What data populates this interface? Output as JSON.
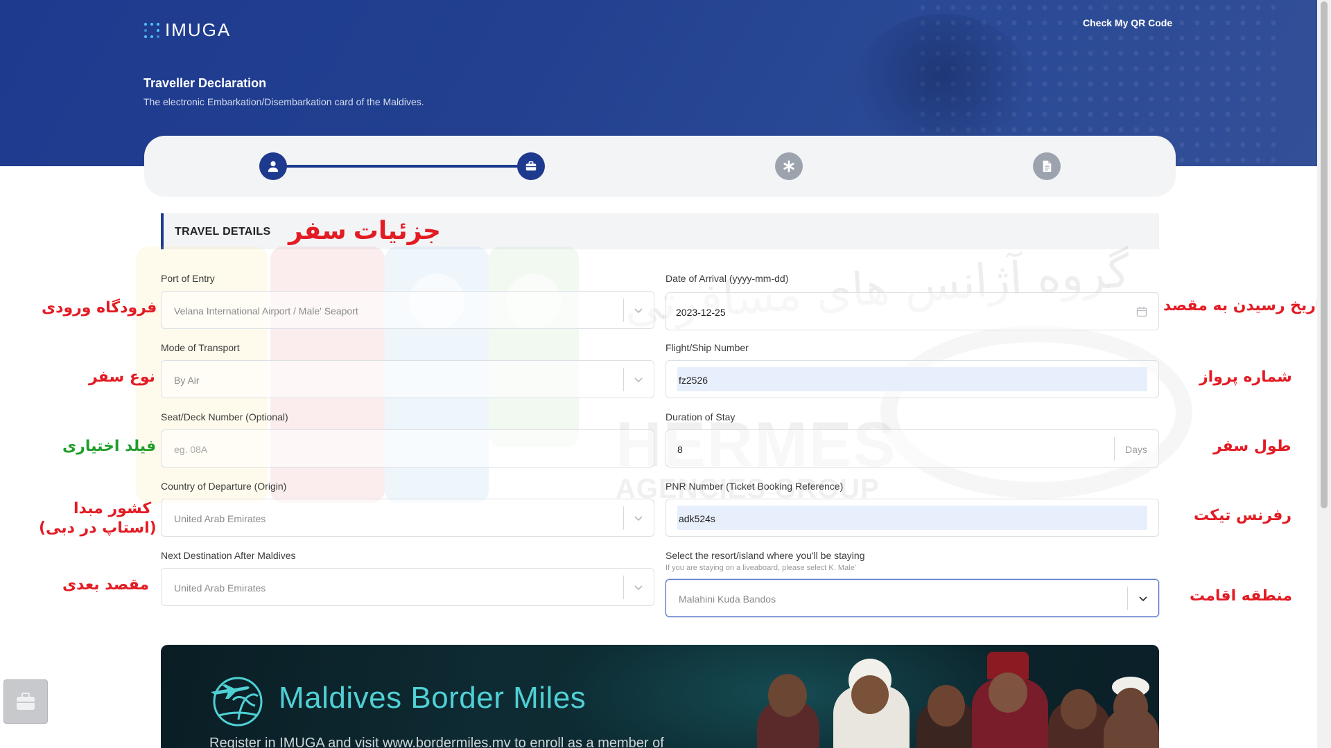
{
  "header": {
    "logo_text": "IMUGA",
    "qr_link": "Check My QR Code",
    "title": "Traveller Declaration",
    "subtitle": "The electronic Embarkation/Disembarkation card of the Maldives."
  },
  "stepper": {
    "steps": [
      {
        "icon": "user-icon",
        "state": "done"
      },
      {
        "icon": "briefcase-icon",
        "state": "active"
      },
      {
        "icon": "asterisk-icon",
        "state": "pending"
      },
      {
        "icon": "document-icon",
        "state": "pending"
      }
    ]
  },
  "section": {
    "title": "TRAVEL DETAILS",
    "annotation": "جزئیات سفر"
  },
  "form": {
    "port_of_entry": {
      "label": "Port of Entry",
      "value": "Velana International Airport / Male' Seaport",
      "annotation": "فرودگاه ورودی"
    },
    "date_of_arrival": {
      "label": "Date of Arrival (yyyy-mm-dd)",
      "value": "2023-12-25",
      "annotation": "تاریخ رسیدن به مقصد"
    },
    "mode_of_transport": {
      "label": "Mode of Transport",
      "value": "By Air",
      "annotation": "نوع سفر"
    },
    "flight_number": {
      "label": "Flight/Ship Number",
      "value": "fz2526",
      "annotation": "شماره پرواز"
    },
    "seat_number": {
      "label": "Seat/Deck Number (Optional)",
      "placeholder": "eg. 08A",
      "annotation": "فیلد اختیاری"
    },
    "duration_of_stay": {
      "label": "Duration of Stay",
      "value": "8",
      "suffix": "Days",
      "annotation": "طول سفر"
    },
    "country_of_departure": {
      "label": "Country of Departure (Origin)",
      "value": "United Arab Emirates",
      "annotation_line1": "کشور مبدا",
      "annotation_line2": "(استاپ در دبی)"
    },
    "pnr_number": {
      "label": "PNR Number (Ticket Booking Reference)",
      "value": "adk524s",
      "annotation": "رفرنس تیکت"
    },
    "next_destination": {
      "label": "Next Destination After Maldives",
      "value": "United Arab Emirates",
      "annotation": "مقصد بعدی"
    },
    "resort": {
      "label": "Select the resort/island where you'll be staying",
      "hint": "If you are staying on a liveaboard, please select K. Male'",
      "value": "Malahini Kuda Bandos",
      "annotation": "منطقه اقامت"
    }
  },
  "watermark": {
    "fa_text": "گروه آژانس های مسافرتی",
    "brand": "HERMES",
    "brand_sub": "AGENCIES GROUP"
  },
  "banner": {
    "title": "Maldives Border Miles",
    "text": "Register in IMUGA and visit www.bordermiles.mv to enroll as a member of"
  },
  "colors": {
    "primary": "#1e3a8f",
    "annotation_red": "#e31b23",
    "annotation_green": "#1f9e2a",
    "banner_teal": "#4fd0d4"
  }
}
